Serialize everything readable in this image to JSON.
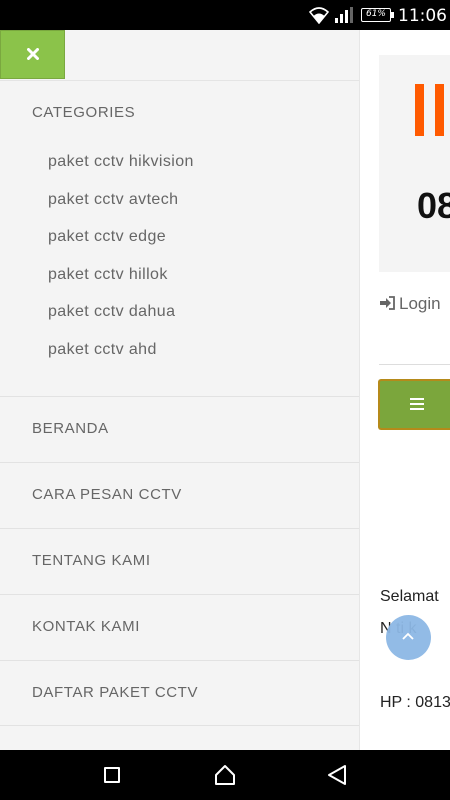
{
  "status_bar": {
    "battery_percent": "61%",
    "time": "11:06"
  },
  "drawer": {
    "close_icon": "close-icon",
    "categories": {
      "heading": "CATEGORIES",
      "items": [
        "paket cctv hikvision",
        "paket cctv avtech",
        "paket cctv edge",
        "paket cctv hillok",
        "paket cctv dahua",
        "paket cctv ahd"
      ]
    },
    "nav_items": [
      "BERANDA",
      "CARA PESAN CCTV",
      "TENTANG KAMI",
      "KONTAK KAMI",
      "DAFTAR PAKET CCTV"
    ]
  },
  "main": {
    "phone_partial": "08",
    "login_label": "Login",
    "welcome_partial": "Selamat",
    "welcome_partial_2": "N   ti k",
    "hp_partial": "HP : 0813"
  },
  "colors": {
    "drawer_bg": "#f4f4f4",
    "close_button": "#8bc34a",
    "menu_toggle": "#7ba63c",
    "logo_orange": "#ff5a00",
    "scroll_top": "#8db8e5"
  }
}
